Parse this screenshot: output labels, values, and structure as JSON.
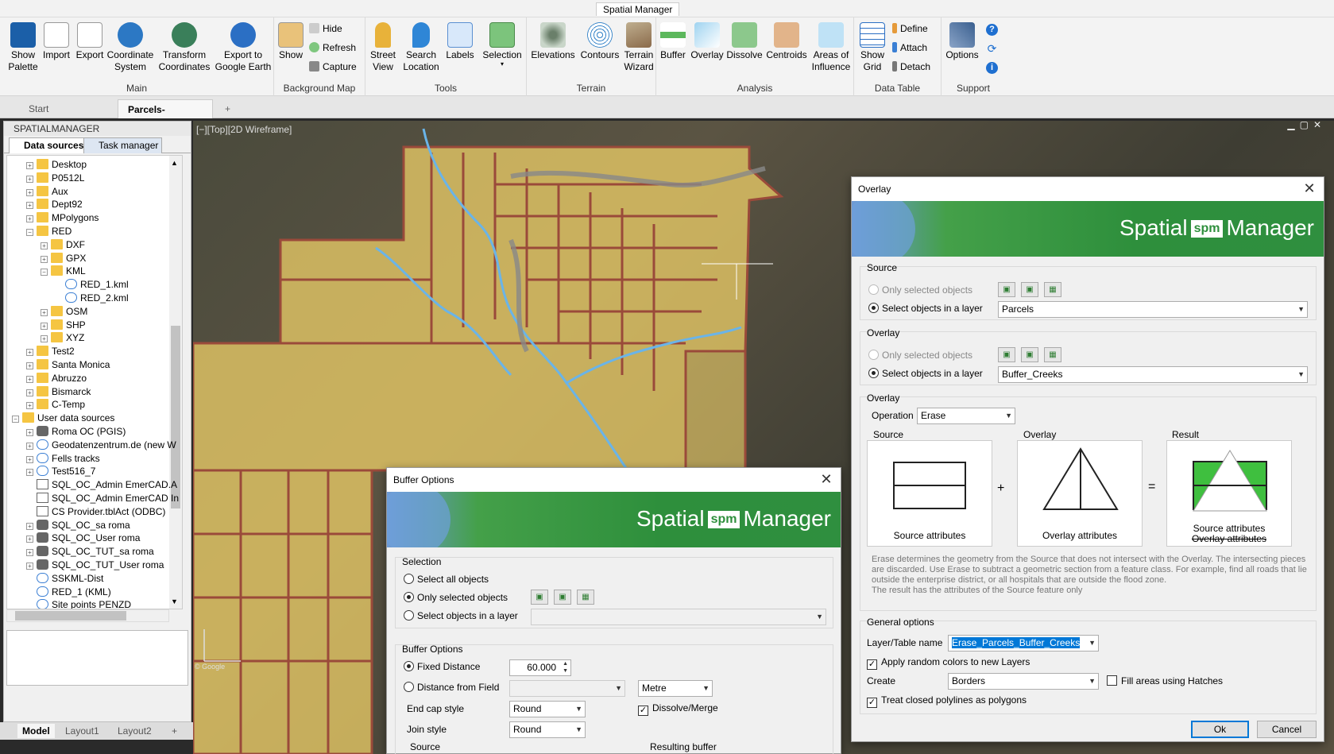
{
  "window": {
    "title": "Spatial Manager"
  },
  "ribbon": {
    "groups": {
      "main": "Main",
      "background_map": "Background Map",
      "tools": "Tools",
      "terrain": "Terrain",
      "analysis": "Analysis",
      "data_table": "Data Table",
      "support": "Support"
    },
    "main": {
      "show_palette": "Show\nPalette",
      "import": "Import",
      "export": "Export",
      "coordinate_system": "Coordinate\nSystem",
      "transform_coordinates": "Transform\nCoordinates",
      "export_google_earth": "Export to\nGoogle Earth"
    },
    "background_map": {
      "show": "Show",
      "hide": "Hide",
      "refresh": "Refresh",
      "capture": "Capture"
    },
    "tools": {
      "street_view": "Street\nView",
      "search_location": "Search\nLocation",
      "labels": "Labels",
      "selection": "Selection"
    },
    "terrain": {
      "elevations": "Elevations",
      "contours": "Contours",
      "terrain_wizard": "Terrain\nWizard"
    },
    "analysis": {
      "buffer": "Buffer",
      "overlay": "Overlay",
      "dissolve": "Dissolve",
      "centroids": "Centroids",
      "areas_of_influence": "Areas of\nInfluence"
    },
    "data_table": {
      "show_grid": "Show\nGrid",
      "define": "Define",
      "attach": "Attach",
      "detach": "Detach"
    },
    "support": {
      "options": "Options"
    }
  },
  "doc_tabs": {
    "start": "Start",
    "active": "Parcels-Rivers*",
    "close": "✕",
    "add": "+"
  },
  "palette": {
    "title": "SPATIALMANAGER",
    "tab_data_sources": "Data sources",
    "tab_task_manager": "Task manager",
    "tree": [
      {
        "label": "Desktop",
        "indent": 0,
        "icon": "folder",
        "exp": "+"
      },
      {
        "label": "P0512L",
        "indent": 0,
        "icon": "folder",
        "exp": "+"
      },
      {
        "label": "Aux",
        "indent": 0,
        "icon": "folder",
        "exp": "+"
      },
      {
        "label": "Dept92",
        "indent": 0,
        "icon": "folder",
        "exp": "+"
      },
      {
        "label": "MPolygons",
        "indent": 0,
        "icon": "folder",
        "exp": "+"
      },
      {
        "label": "RED",
        "indent": 0,
        "icon": "folder",
        "exp": "−"
      },
      {
        "label": "DXF",
        "indent": 1,
        "icon": "folder",
        "exp": "+"
      },
      {
        "label": "GPX",
        "indent": 1,
        "icon": "folder",
        "exp": "+"
      },
      {
        "label": "KML",
        "indent": 1,
        "icon": "folder",
        "exp": "−"
      },
      {
        "label": "RED_1.kml",
        "indent": 2,
        "icon": "kml",
        "exp": ""
      },
      {
        "label": "RED_2.kml",
        "indent": 2,
        "icon": "kml",
        "exp": ""
      },
      {
        "label": "OSM",
        "indent": 1,
        "icon": "folder",
        "exp": "+"
      },
      {
        "label": "SHP",
        "indent": 1,
        "icon": "folder",
        "exp": "+"
      },
      {
        "label": "XYZ",
        "indent": 1,
        "icon": "folder",
        "exp": "+"
      },
      {
        "label": "Test2",
        "indent": 0,
        "icon": "folder",
        "exp": "+"
      },
      {
        "label": "Santa Monica",
        "indent": 0,
        "icon": "folder",
        "exp": "+"
      },
      {
        "label": "Abruzzo",
        "indent": 0,
        "icon": "folder",
        "exp": "+"
      },
      {
        "label": "Bismarck",
        "indent": 0,
        "icon": "folder",
        "exp": "+"
      },
      {
        "label": "C-Temp",
        "indent": 0,
        "icon": "folder",
        "exp": "+"
      },
      {
        "label": "User data sources",
        "indent": -1,
        "icon": "user",
        "exp": "−"
      },
      {
        "label": "Roma OC (PGIS)",
        "indent": 0,
        "icon": "db",
        "exp": "+"
      },
      {
        "label": "Geodatenzentrum.de (new W",
        "indent": 0,
        "icon": "kml",
        "exp": "+"
      },
      {
        "label": "Fells tracks",
        "indent": 0,
        "icon": "kml",
        "exp": "+"
      },
      {
        "label": "Test516_7",
        "indent": 0,
        "icon": "kml",
        "exp": "+"
      },
      {
        "label": "SQL_OC_Admin EmerCAD.A",
        "indent": 0,
        "icon": "table",
        "exp": ""
      },
      {
        "label": "SQL_OC_Admin EmerCAD In",
        "indent": 0,
        "icon": "table",
        "exp": ""
      },
      {
        "label": "CS Provider.tblAct (ODBC)",
        "indent": 0,
        "icon": "table",
        "exp": ""
      },
      {
        "label": "SQL_OC_sa roma",
        "indent": 0,
        "icon": "db",
        "exp": "+"
      },
      {
        "label": "SQL_OC_User roma",
        "indent": 0,
        "icon": "db",
        "exp": "+"
      },
      {
        "label": "SQL_OC_TUT_sa roma",
        "indent": 0,
        "icon": "db",
        "exp": "+"
      },
      {
        "label": "SQL_OC_TUT_User roma",
        "indent": 0,
        "icon": "db",
        "exp": "+"
      },
      {
        "label": "SSKML-Dist",
        "indent": 0,
        "icon": "kml",
        "exp": ""
      },
      {
        "label": "RED_1 (KML)",
        "indent": 0,
        "icon": "kml",
        "exp": ""
      },
      {
        "label": "Site points PENZD",
        "indent": 0,
        "icon": "pts",
        "exp": ""
      }
    ]
  },
  "model_tabs": {
    "model": "Model",
    "layout1": "Layout1",
    "layout2": "Layout2",
    "add": "+"
  },
  "viewport": {
    "label": "[−][Top][2D Wireframe]",
    "watermark": "© Google"
  },
  "brand": {
    "left": "Spatial",
    "logo": "spm",
    "right": "Manager"
  },
  "buffer_dialog": {
    "title": "Buffer Options",
    "selection_legend": "Selection",
    "select_all": "Select all objects",
    "only_selected": "Only selected objects",
    "select_layer": "Select objects in a layer",
    "options_legend": "Buffer Options",
    "fixed_distance": "Fixed Distance",
    "distance_value": "60.000",
    "distance_from_field": "Distance from Field",
    "unit": "Metre",
    "end_cap_label": "End cap style",
    "end_cap_value": "Round",
    "dissolve_merge": "Dissolve/Merge",
    "join_label": "Join style",
    "join_value": "Round",
    "source_legend": "Source",
    "resulting_legend": "Resulting buffer"
  },
  "overlay_dialog": {
    "title": "Overlay",
    "source_legend": "Source",
    "source_only_selected": "Only selected objects",
    "source_select_layer": "Select objects in a layer",
    "source_layer": "Parcels",
    "overlay_legend": "Overlay",
    "overlay_only_selected": "Only selected objects",
    "overlay_select_layer": "Select objects in a layer",
    "overlay_layer": "Buffer_Creeks",
    "operation_legend": "Overlay",
    "operation_label": "Operation",
    "operation_value": "Erase",
    "pic_source_title": "Source",
    "pic_source_caption": "Source attributes",
    "pic_overlay_title": "Overlay",
    "pic_overlay_caption": "Overlay attributes",
    "pic_result_title": "Result",
    "pic_result_caption1": "Source attributes",
    "pic_result_caption2": "Overlay attributes",
    "plus": "+",
    "equals": "=",
    "description": "Erase determines the geometry from the Source that does not intersect with the Overlay. The intersecting pieces are discarded. Use Erase to subtract a geometric section from a feature class. For example, find all roads that lie outside the enterprise district, or all hospitals that are outside the flood zone.\nThe result has the attributes of the Source feature only",
    "general_legend": "General options",
    "layer_name_label": "Layer/Table name",
    "layer_name_value": "Erase_Parcels_Buffer_Creeks",
    "random_colors": "Apply random colors to new Layers",
    "create_label": "Create",
    "create_value": "Borders",
    "fill_hatches": "Fill areas using Hatches",
    "closed_polylines": "Treat closed polylines as polygons",
    "ok": "Ok",
    "cancel": "Cancel"
  },
  "colors": {
    "accent": "#2e8f3c",
    "parcel_fill": "#f4d46a",
    "parcel_border": "#9a4a3a",
    "creek": "#6ab4e8"
  }
}
